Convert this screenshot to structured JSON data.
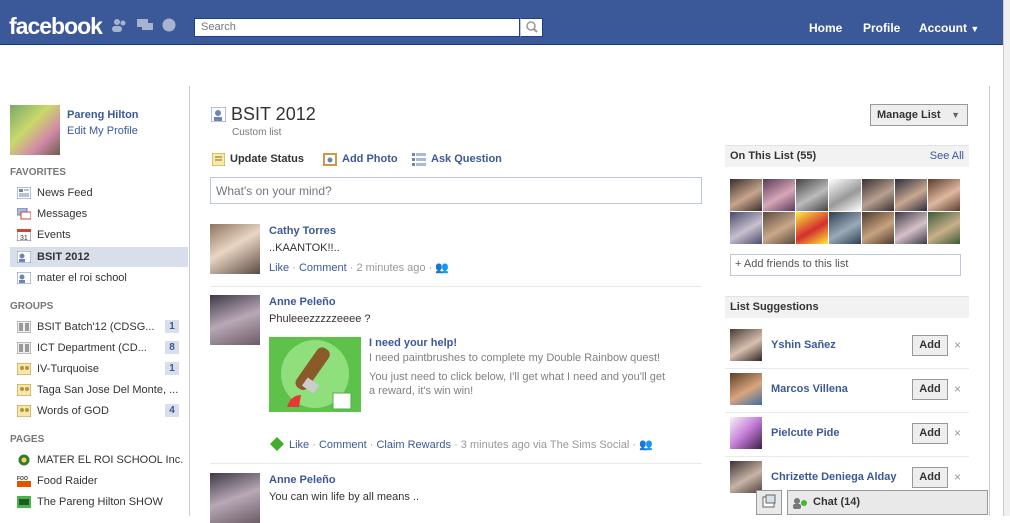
{
  "topbar": {
    "logo": "facebook",
    "search_placeholder": "Search",
    "nav": {
      "home": "Home",
      "profile": "Profile",
      "account": "Account"
    }
  },
  "user": {
    "name": "Pareng Hilton",
    "edit_profile": "Edit My Profile"
  },
  "favorites": {
    "title": "FAVORITES",
    "items": [
      {
        "label": "News Feed",
        "icon": "news-feed-icon"
      },
      {
        "label": "Messages",
        "icon": "messages-icon"
      },
      {
        "label": "Events",
        "icon": "events-icon"
      },
      {
        "label": "BSIT 2012",
        "icon": "list-icon",
        "active": true
      },
      {
        "label": "mater el roi school",
        "icon": "list-icon"
      }
    ]
  },
  "groups": {
    "title": "GROUPS",
    "items": [
      {
        "label": "BSIT Batch'12 (CDSG...",
        "count": "1"
      },
      {
        "label": "ICT Department (CD...",
        "count": "8"
      },
      {
        "label": "IV-Turquoise",
        "count": "1"
      },
      {
        "label": "Taga San Jose Del Monte, ...",
        "count": ""
      },
      {
        "label": "Words of GOD",
        "count": "4"
      }
    ]
  },
  "pages": {
    "title": "PAGES",
    "items": [
      {
        "label": "MATER EL ROI SCHOOL Inc."
      },
      {
        "label": "Food Raider"
      },
      {
        "label": "The Pareng Hilton SHOW"
      }
    ]
  },
  "list": {
    "title": "BSIT 2012",
    "subtitle": "Custom list",
    "manage_button": "Manage List"
  },
  "composer": {
    "update_status": "Update Status",
    "add_photo": "Add Photo",
    "ask_question": "Ask Question",
    "placeholder": "What's on your mind?"
  },
  "stories": [
    {
      "name": "Cathy Torres",
      "text": "..KAANTOK!!..",
      "like": "Like",
      "comment": "Comment",
      "time": "2 minutes ago"
    },
    {
      "name": "Anne Peleño",
      "text": "Phuleeezzzzzeeee ?",
      "attachment": {
        "title": "I need your help!",
        "line1": "I need paintbrushes to complete my Double Rainbow quest!",
        "line2": "You just need to click below, I'll get what I need and you'll get",
        "line3": "a reward, it's win win!"
      },
      "like": "Like",
      "comment": "Comment",
      "claim": "Claim Rewards",
      "time": "3 minutes ago via The Sims Social"
    },
    {
      "name": "Anne Peleño",
      "text": "You can win life by all means .."
    }
  ],
  "on_list": {
    "title": "On This List (55)",
    "see_all": "See All",
    "add_friends": "+ Add friends to this list"
  },
  "suggestions": {
    "title": "List Suggestions",
    "add_label": "Add",
    "remove_label": "×",
    "people": [
      {
        "name": "Yshin Sañez"
      },
      {
        "name": "Marcos Villena"
      },
      {
        "name": "Pielcute Pide"
      },
      {
        "name": "Chrizette Deniega Alday"
      }
    ]
  },
  "chat": {
    "label": "Chat (14)"
  },
  "colors": {
    "brand": "#3b5998",
    "online": "#42b72a"
  }
}
